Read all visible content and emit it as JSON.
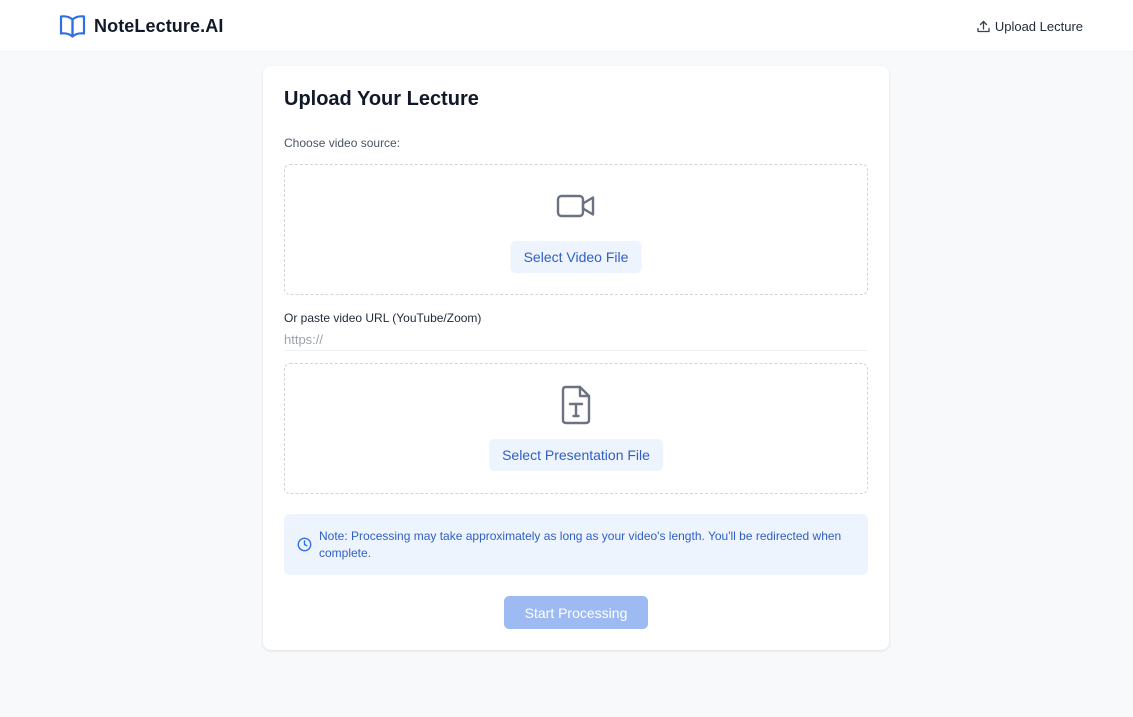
{
  "header": {
    "brand_name": "NoteLecture.AI",
    "brand_icon": "open-book-icon",
    "nav_upload_label": "Upload Lecture",
    "nav_upload_icon": "upload-icon"
  },
  "upload_form": {
    "title": "Upload Your Lecture",
    "source_label": "Choose video source:",
    "video_dropzone": {
      "icon": "video-camera-icon",
      "button_label": "Select Video File"
    },
    "url_field": {
      "label": "Or paste video URL (YouTube/Zoom)",
      "placeholder": "https://",
      "value": ""
    },
    "presentation_dropzone": {
      "icon": "text-file-icon",
      "button_label": "Select Presentation File"
    },
    "note": {
      "icon": "clock-icon",
      "text": "Note: Processing may take approximately as long as your video's length. You'll be redirected when complete."
    },
    "submit_label": "Start Processing"
  },
  "colors": {
    "accent": "#2f5fc5",
    "accent_light": "#eef4fd",
    "submit_disabled": "#9dbaf3",
    "page_background": "#f8f9fb"
  }
}
